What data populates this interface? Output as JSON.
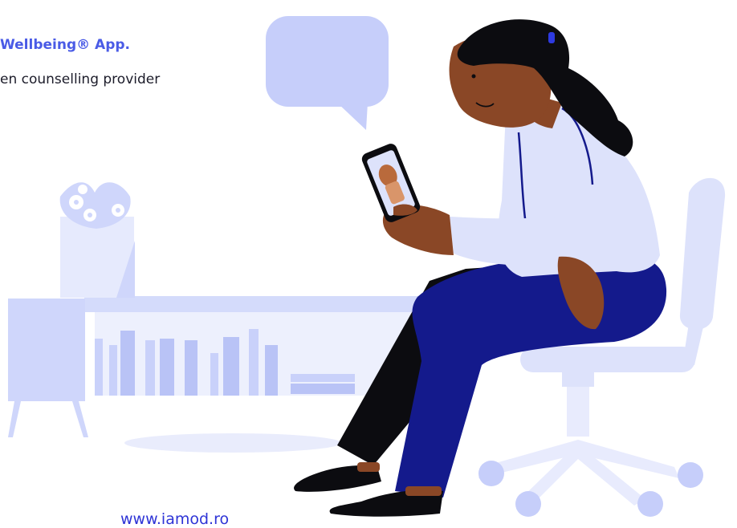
{
  "hero": {
    "headline": "Wellbeing® App.",
    "subline": "en counselling provider",
    "link_text": "www.iamod.ro"
  },
  "colors": {
    "accent": "#4a5be6",
    "link": "#2e34d6",
    "pale": "#dfe3fb",
    "light": "#c4ccfa",
    "mid": "#aeb8f2",
    "navy": "#141a8c",
    "skin": "#8a4726",
    "hair": "#0c0c10",
    "shirt": "#dde2fb"
  },
  "icons": [
    "speech-bubble-icon"
  ]
}
